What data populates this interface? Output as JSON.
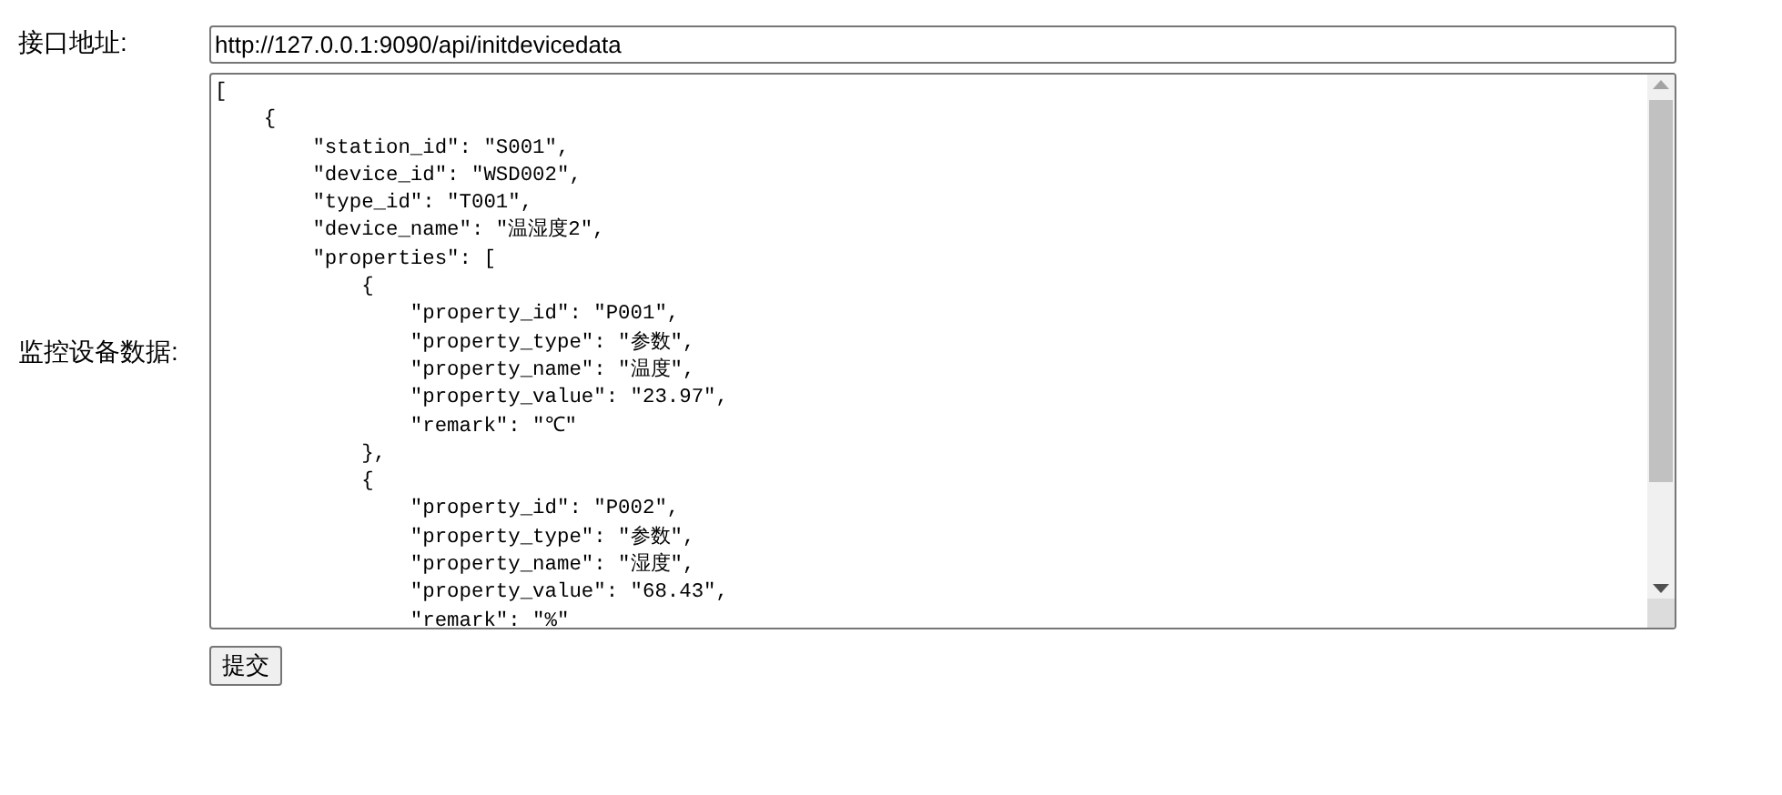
{
  "url_field": {
    "label": "接口地址:",
    "value": "http://127.0.0.1:9090/api/initdevicedata"
  },
  "data_field": {
    "label": "监控设备数据:",
    "lines": [
      "[",
      "    {",
      "        \"station_id\": \"S001\",",
      "        \"device_id\": \"WSD002\",",
      "        \"type_id\": \"T001\",",
      "        \"device_name\": \"温湿度2\",",
      "        \"properties\": [",
      "            {",
      "                \"property_id\": \"P001\",",
      "                \"property_type\": \"参数\",",
      "                \"property_name\": \"温度\",",
      "                \"property_value\": \"23.97\",",
      "                \"remark\": \"℃\"",
      "            },",
      "            {",
      "                \"property_id\": \"P002\",",
      "                \"property_type\": \"参数\",",
      "                \"property_name\": \"湿度\",",
      "                \"property_value\": \"68.43\",",
      "                \"remark\": \"%\""
    ]
  },
  "submit_button": {
    "label": "提交"
  }
}
